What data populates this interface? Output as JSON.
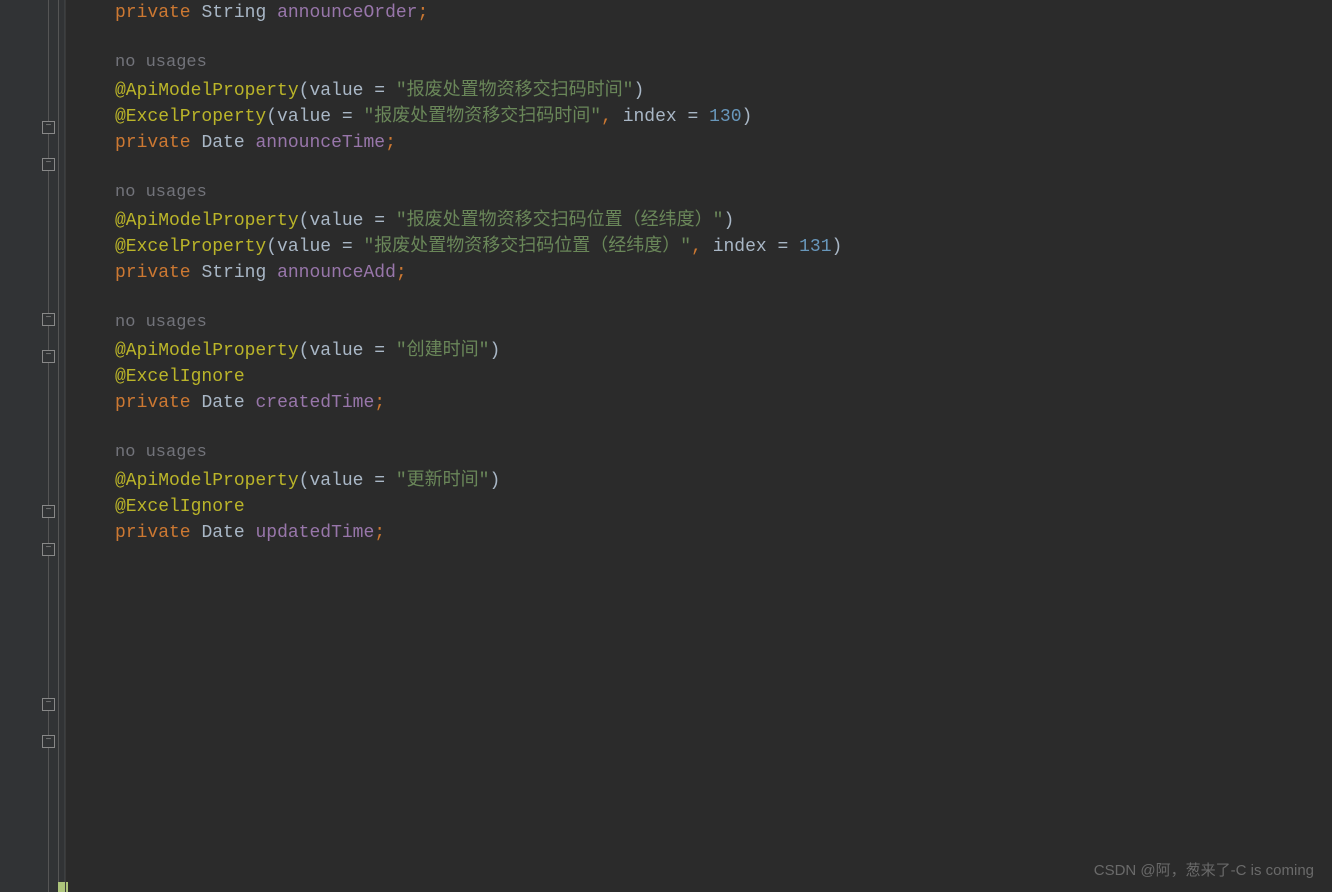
{
  "field0": {
    "private": "private",
    "type": "String",
    "name": "announceOrder",
    "semi": ";"
  },
  "hint_no_usages": "no usages",
  "block1": {
    "api_prefix": "@ApiModelProperty",
    "api_lparen": "(",
    "api_value_key": "value",
    "api_eq": " = ",
    "api_value_str": "\"报废处置物资移交扫码时间\"",
    "api_rparen": ")",
    "excel_prefix": "@ExcelProperty",
    "excel_lparen": "(",
    "excel_value_key": "value",
    "excel_eq1": " = ",
    "excel_value_str": "\"报废处置物资移交扫码时间\"",
    "excel_comma": ", ",
    "excel_index_key": "index",
    "excel_eq2": " = ",
    "excel_index_num": "130",
    "excel_rparen": ")",
    "private": "private",
    "type": "Date",
    "name": "announceTime",
    "semi": ";"
  },
  "block2": {
    "api_prefix": "@ApiModelProperty",
    "api_lparen": "(",
    "api_value_key": "value",
    "api_eq": " = ",
    "api_value_str": "\"报废处置物资移交扫码位置（经纬度）\"",
    "api_rparen": ")",
    "excel_prefix": "@ExcelProperty",
    "excel_lparen": "(",
    "excel_value_key": "value",
    "excel_eq1": " = ",
    "excel_value_str": "\"报废处置物资移交扫码位置（经纬度）\"",
    "excel_comma": ", ",
    "excel_index_key": "index",
    "excel_eq2": " = ",
    "excel_index_num": "131",
    "excel_rparen": ")",
    "private": "private",
    "type": "String",
    "name": "announceAdd",
    "semi": ";"
  },
  "block3": {
    "api_prefix": "@ApiModelProperty",
    "api_lparen": "(",
    "api_value_key": "value",
    "api_eq": " = ",
    "api_value_str": "\"创建时间\"",
    "api_rparen": ")",
    "excel_ignore": "@ExcelIgnore",
    "private": "private",
    "type": "Date",
    "name": "createdTime",
    "semi": ";"
  },
  "block4": {
    "api_prefix": "@ApiModelProperty",
    "api_lparen": "(",
    "api_value_key": "value",
    "api_eq": " = ",
    "api_value_str": "\"更新时间\"",
    "api_rparen": ")",
    "excel_ignore": "@ExcelIgnore",
    "private": "private",
    "type": "Date",
    "name": "updatedTime",
    "semi": ";"
  },
  "watermark": "CSDN @阿，葱来了-C is coming"
}
